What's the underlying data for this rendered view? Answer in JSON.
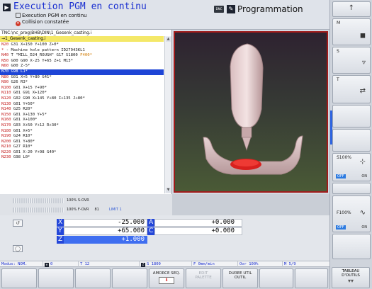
{
  "header": {
    "mode_title": "Execution PGM en continu",
    "subtitle": "Execution PGM en continu",
    "error_message": "Collision constatée",
    "dnc_label": "DNC",
    "secondary_mode": "Programmation"
  },
  "program": {
    "path": "TNC:\\nc_prog\\BHB\\DIN\\1_Gesenk_casting.i",
    "file_tab": "→1_Gesenk_casting.i",
    "selected_index": 5,
    "lines": [
      {
        "n": "N20",
        "code": " G31 X+150 Y+100 Z+0*"
      },
      {
        "n": "*",
        "code": " - Machine hole pattern ID27943KL1"
      },
      {
        "n": "N40",
        "code": " T \"MILL_D24_ROUGH\" G17 S1800 ",
        "hl": "F400*"
      },
      {
        "n": "N50",
        "code": " G00 G90 X-25 Y+65 Z+1 M13*"
      },
      {
        "n": "N60",
        "code": " G00 Z-5*"
      },
      {
        "n": "N70",
        "code": " G98 L1*"
      },
      {
        "n": "N80",
        "code": " G01 X+5 Y+80 G41*"
      },
      {
        "n": "N90",
        "code": " G26 R3*"
      },
      {
        "n": "N100",
        "code": " G01 X+15 Y+90*"
      },
      {
        "n": "N110",
        "code": " G01 G91 X+120*"
      },
      {
        "n": "N120",
        "code": " G02 G90 X+145 Y+80 I+135 J+80*"
      },
      {
        "n": "N130",
        "code": " G01 Y+50*"
      },
      {
        "n": "N140",
        "code": " G25 R20*"
      },
      {
        "n": "N150",
        "code": " G01 X+130 Y+5*"
      },
      {
        "n": "N160",
        "code": " G01 X+100*"
      },
      {
        "n": "N170",
        "code": " G03 X+50 Y+12 R+30*"
      },
      {
        "n": "N180",
        "code": " G01 X+5*"
      },
      {
        "n": "N190",
        "code": " G24 R10*"
      },
      {
        "n": "N200",
        "code": " G01 Y+80*"
      },
      {
        "n": "N210",
        "code": " G27 R10*"
      },
      {
        "n": "N220",
        "code": " G01 X-20 Y+98 G40*"
      },
      {
        "n": "N230",
        "code": " G98 L0*"
      }
    ]
  },
  "overrides": {
    "s_ovr": "100% S-OVR",
    "f_ovr": "100% F-OVR",
    "f_extra": "81",
    "limit": "LIMIT 1"
  },
  "positions": {
    "rows": [
      {
        "axis": "X",
        "value": "-25.000",
        "axis2": "A",
        "value2": "+0.000"
      },
      {
        "axis": "Y",
        "value": "+65.000",
        "axis2": "C",
        "value2": "+0.000"
      },
      {
        "axis": "Z",
        "value": "+1.000",
        "axis2": "",
        "value2": ""
      }
    ],
    "active_axis": "Z"
  },
  "status": {
    "mode": "Modus: NOM.",
    "zero": "0",
    "tool": "T 12",
    "tool_axis": "Z",
    "spindle": "S 1800",
    "feed": "F 0mm/min",
    "ovr": "Ovr 100%",
    "mfunc": "M 5/9"
  },
  "softkeys": {
    "amorce": "AMORCE SEQ.",
    "edit_top": "EDIT",
    "edit_bottom": "PALETTE",
    "duree_top": "DUREE UTIL",
    "duree_bottom": "OUTIL",
    "tableau": "TABLEAU D'OUTILS"
  },
  "right_softkeys": {
    "m_label": "M",
    "s_label": "S",
    "t_label": "T",
    "s_override": "S100%",
    "f_override": "F100%",
    "off_label": "OFF",
    "on_label": "ON"
  }
}
